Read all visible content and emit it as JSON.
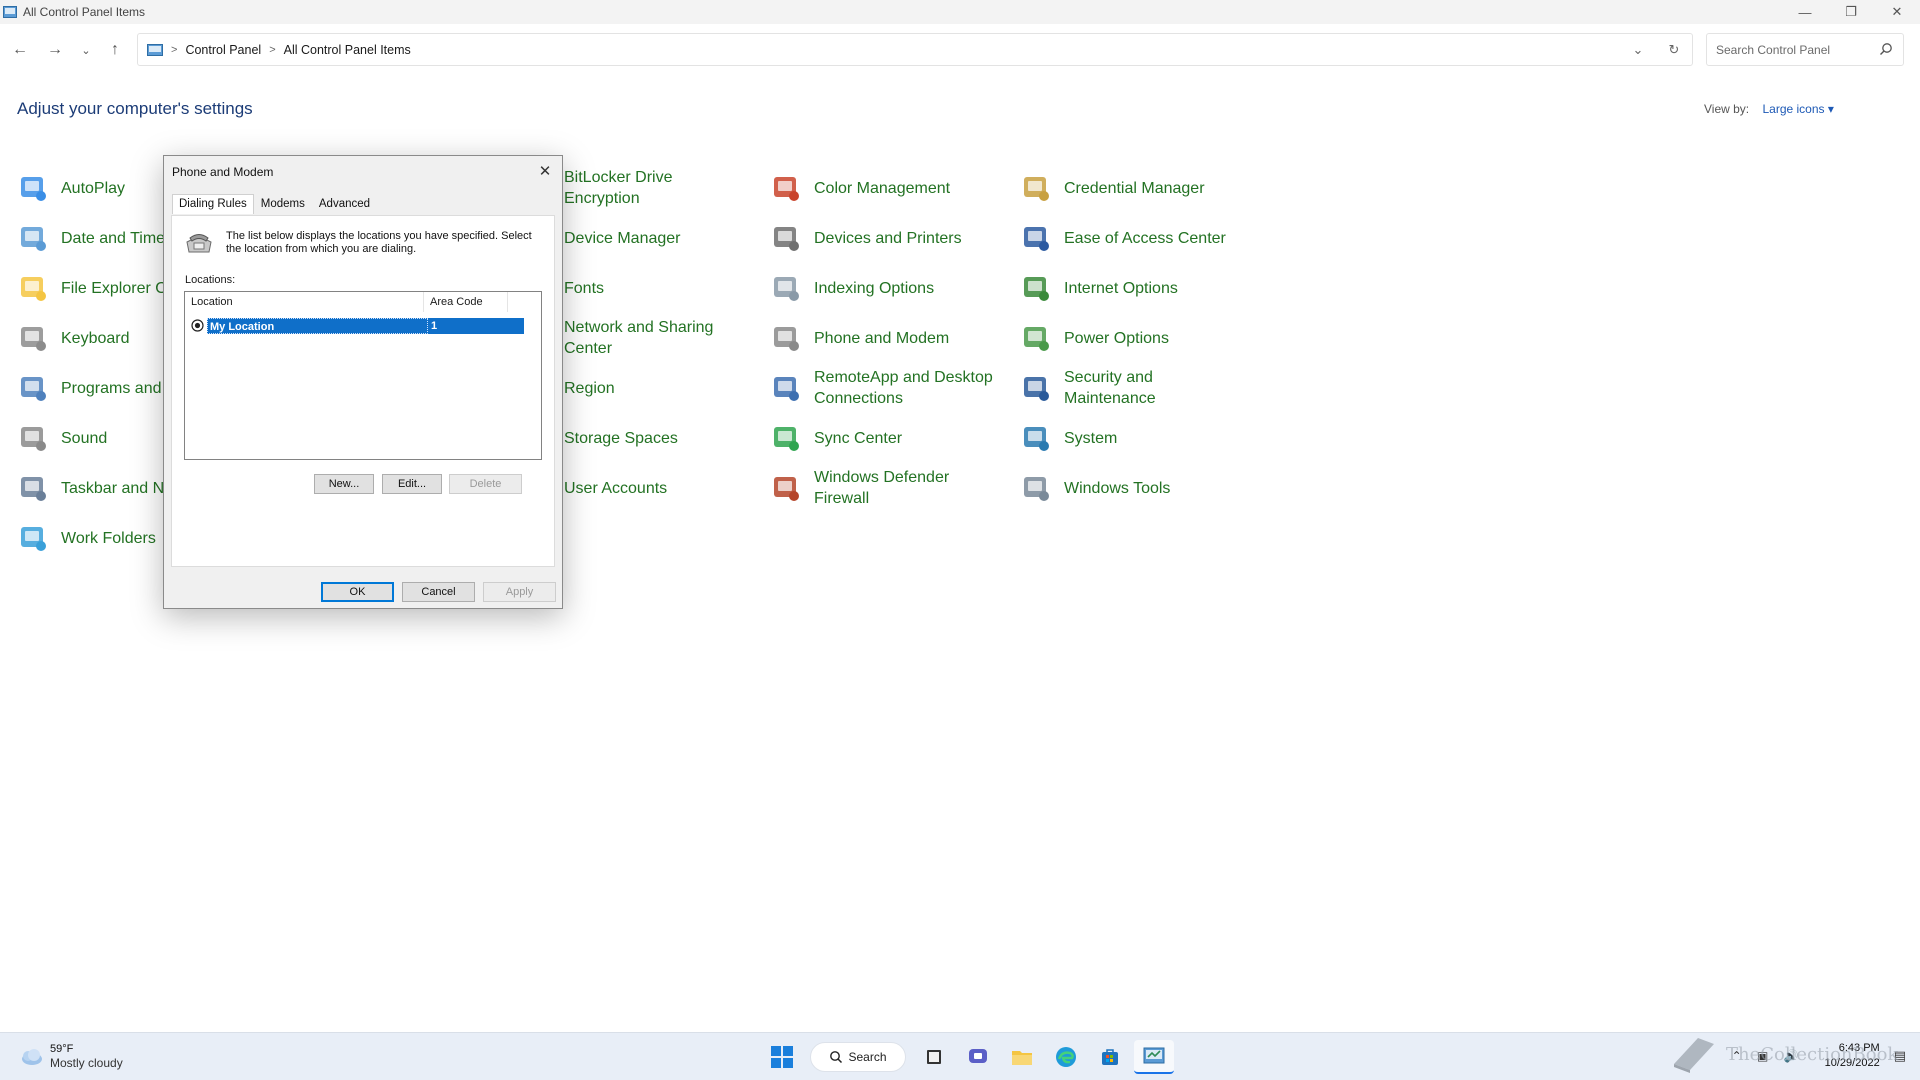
{
  "window": {
    "title": "All Control Panel Items"
  },
  "nav": {
    "breadcrumb": [
      "Control Panel",
      "All Control Panel Items"
    ],
    "search_placeholder": "Search Control Panel"
  },
  "heading": "Adjust your computer's settings",
  "view_by": {
    "label": "View by:",
    "value": "Large icons"
  },
  "items": [
    {
      "label": "AutoPlay",
      "icon": "autoplay-icon"
    },
    {
      "label": "Date and Time",
      "icon": "date-time-icon"
    },
    {
      "label": "File Explorer O",
      "icon": "file-explorer-options-icon"
    },
    {
      "label": "Keyboard",
      "icon": "keyboard-icon"
    },
    {
      "label": "Programs and",
      "icon": "programs-features-icon"
    },
    {
      "label": "Sound",
      "icon": "sound-icon"
    },
    {
      "label": "Taskbar and Na",
      "icon": "taskbar-navigation-icon"
    },
    {
      "label": "Work Folders",
      "icon": "work-folders-icon"
    },
    {
      "label": "BitLocker Drive Encryption",
      "icon": "bitlocker-icon"
    },
    {
      "label": "Device Manager",
      "icon": "device-manager-icon"
    },
    {
      "label": "Fonts",
      "icon": "fonts-icon"
    },
    {
      "label": "Network and Sharing Center",
      "icon": "network-sharing-icon"
    },
    {
      "label": "Region",
      "icon": "region-icon"
    },
    {
      "label": "Storage Spaces",
      "icon": "storage-spaces-icon"
    },
    {
      "label": "User Accounts",
      "icon": "user-accounts-icon"
    },
    {
      "label": "Color Management",
      "icon": "color-management-icon"
    },
    {
      "label": "Devices and Printers",
      "icon": "devices-printers-icon"
    },
    {
      "label": "Indexing Options",
      "icon": "indexing-options-icon"
    },
    {
      "label": "Phone and Modem",
      "icon": "phone-modem-icon"
    },
    {
      "label": "RemoteApp and Desktop Connections",
      "icon": "remoteapp-icon"
    },
    {
      "label": "Sync Center",
      "icon": "sync-center-icon"
    },
    {
      "label": "Windows Defender Firewall",
      "icon": "firewall-icon"
    },
    {
      "label": "Credential Manager",
      "icon": "credential-manager-icon"
    },
    {
      "label": "Ease of Access Center",
      "icon": "ease-of-access-icon"
    },
    {
      "label": "Internet Options",
      "icon": "internet-options-icon"
    },
    {
      "label": "Power Options",
      "icon": "power-options-icon"
    },
    {
      "label": "Security and Maintenance",
      "icon": "security-maintenance-icon"
    },
    {
      "label": "System",
      "icon": "system-icon"
    },
    {
      "label": "Windows Tools",
      "icon": "windows-tools-icon"
    }
  ],
  "dialog": {
    "title": "Phone and Modem",
    "tabs": [
      "Dialing Rules",
      "Modems",
      "Advanced"
    ],
    "active_tab": "Dialing Rules",
    "description": "The list below displays the locations you have specified. Select the location from which you are dialing.",
    "locations_label": "Locations:",
    "columns": [
      "Location",
      "Area Code"
    ],
    "rows": [
      {
        "location": "My Location",
        "area_code": "1",
        "selected": true
      }
    ],
    "buttons": {
      "new": "New...",
      "edit": "Edit...",
      "delete": "Delete",
      "ok": "OK",
      "cancel": "Cancel",
      "apply": "Apply"
    }
  },
  "taskbar": {
    "weather_temp": "59°F",
    "weather_condition": "Mostly cloudy",
    "search_label": "Search",
    "time": "6:43 PM",
    "date": "10/29/2022"
  },
  "watermark": "TheCollectionBook",
  "colors": {
    "link_green": "#237223",
    "heading_blue": "#1c3c77",
    "selection_blue": "#0f6fc9",
    "accent": "#1a73e8"
  }
}
